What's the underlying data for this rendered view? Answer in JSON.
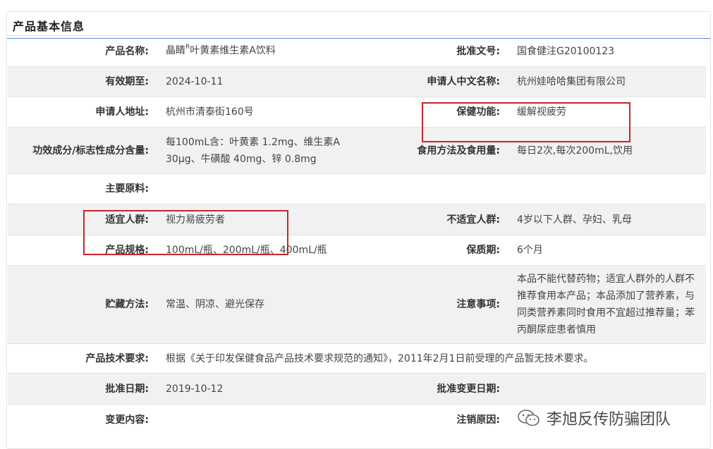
{
  "panel": {
    "title": "产品基本信息"
  },
  "rows": [
    {
      "l1": "产品名称:",
      "v1a": "晶睛",
      "v1sup": "R",
      "v1b": "叶黄素维生素A饮料",
      "l2": "批准文号:",
      "v2": "国食健注G20100123"
    },
    {
      "l1": "有效期至:",
      "v1": "2024-10-11",
      "l2": "申请人中文名称:",
      "v2": "杭州娃哈哈集团有限公司"
    },
    {
      "l1": "申请人地址:",
      "v1": "杭州市清泰街160号",
      "l2": "保健功能:",
      "v2": "缓解视疲劳"
    },
    {
      "l1": "功效成分/标志性成分含量:",
      "v1": "每100mL含：叶黄素 1.2mg、维生素A 30μg、牛磺酸 40mg、锌 0.8mg",
      "l2": "食用方法及食用量:",
      "v2": "每日2次,每次200mL,饮用"
    },
    {
      "l1": "主要原料:",
      "v1": "",
      "l2": "",
      "v2": ""
    },
    {
      "l1": "适宜人群:",
      "v1": "视力易疲劳者",
      "l2": "不适宜人群:",
      "v2": "4岁以下人群、孕妇、乳母"
    },
    {
      "l1": "产品规格:",
      "v1": "100mL/瓶、200mL/瓶、400mL/瓶",
      "l2": "保质期:",
      "v2": "6个月"
    },
    {
      "l1": "贮藏方法:",
      "v1": "常温、阴凉、避光保存",
      "l2": "注意事项:",
      "v2": "本品不能代替药物；适宜人群外的人群不推荐食用本产品；本品添加了营养素，与同类营养素同时食用不宜超过推荐量；苯丙酮尿症患者慎用"
    },
    {
      "l1": "产品技术要求:",
      "v1": "根据《关于印发保健食品产品技术要求规范的通知》，2011年2月1日前受理的产品暂无技术要求。"
    },
    {
      "l1": "批准日期:",
      "v1": "2019-10-12",
      "l2": "批准变更日期:",
      "v2": ""
    },
    {
      "l1": "变更内容:",
      "v1": "",
      "l2": "注销原因:",
      "v2": ""
    }
  ],
  "watermark": {
    "text": "李旭反传防骗团队"
  },
  "colors": {
    "highlight": "#c9252b",
    "header_rule": "#5b8ad6",
    "alt_row": "#f1f1f1"
  }
}
